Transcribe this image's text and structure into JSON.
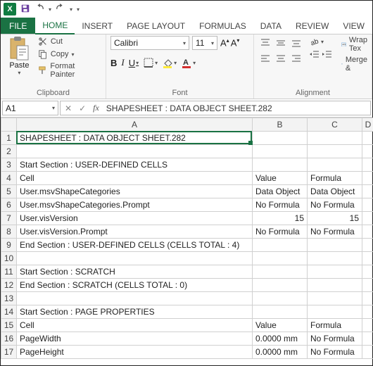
{
  "qat": {
    "app_letter": "X"
  },
  "tabs": {
    "file": "FILE",
    "home": "HOME",
    "insert": "INSERT",
    "page_layout": "PAGE LAYOUT",
    "formulas": "FORMULAS",
    "data": "DATA",
    "review": "REVIEW",
    "view": "VIEW"
  },
  "ribbon": {
    "clipboard": {
      "paste": "Paste",
      "cut": "Cut",
      "copy": "Copy",
      "format_painter": "Format Painter",
      "label": "Clipboard"
    },
    "font": {
      "name": "Calibri",
      "size": "11",
      "bold": "B",
      "italic": "I",
      "underline": "U",
      "label": "Font"
    },
    "alignment": {
      "wrap": "Wrap Tex",
      "merge": "Merge &",
      "label": "Alignment"
    }
  },
  "name_box": "A1",
  "formula_fx": "fx",
  "formula_value": "SHAPESHEET : DATA OBJECT SHEET.282",
  "columns": [
    "A",
    "B",
    "C",
    "D"
  ],
  "rows": [
    {
      "n": "1",
      "A": "SHAPESHEET : DATA OBJECT SHEET.282",
      "B": "",
      "C": ""
    },
    {
      "n": "2",
      "A": "",
      "B": "",
      "C": ""
    },
    {
      "n": "3",
      "A": "Start Section : USER-DEFINED CELLS",
      "B": "",
      "C": ""
    },
    {
      "n": "4",
      "A": "Cell",
      "B": "Value",
      "C": "Formula"
    },
    {
      "n": "5",
      "A": "User.msvShapeCategories",
      "B": "Data Object",
      "C": "Data Object"
    },
    {
      "n": "6",
      "A": "User.msvShapeCategories.Prompt",
      "B": "No Formula",
      "C": "No Formula"
    },
    {
      "n": "7",
      "A": "User.visVersion",
      "B": "15",
      "Br": true,
      "C": "15",
      "Cr": true
    },
    {
      "n": "8",
      "A": "User.visVersion.Prompt",
      "B": "No Formula",
      "C": "No Formula"
    },
    {
      "n": "9",
      "A": "End Section : USER-DEFINED CELLS  (CELLS TOTAL : 4)",
      "B": "",
      "C": ""
    },
    {
      "n": "10",
      "A": "",
      "B": "",
      "C": ""
    },
    {
      "n": "11",
      "A": "Start Section : SCRATCH",
      "B": "",
      "C": ""
    },
    {
      "n": "12",
      "A": "End Section : SCRATCH  (CELLS TOTAL : 0)",
      "B": "",
      "C": ""
    },
    {
      "n": "13",
      "A": "",
      "B": "",
      "C": ""
    },
    {
      "n": "14",
      "A": "Start Section : PAGE PROPERTIES",
      "B": "",
      "C": ""
    },
    {
      "n": "15",
      "A": "Cell",
      "B": "Value",
      "C": "Formula"
    },
    {
      "n": "16",
      "A": "PageWidth",
      "B": "0.0000 mm",
      "C": "No Formula"
    },
    {
      "n": "17",
      "A": "PageHeight",
      "B": "0.0000 mm",
      "C": "No Formula"
    }
  ]
}
